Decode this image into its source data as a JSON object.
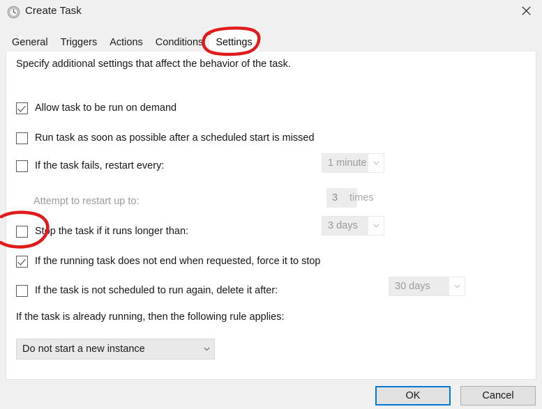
{
  "window": {
    "title": "Create Task",
    "icon": "clock-icon",
    "close_label": "×"
  },
  "tabs": [
    {
      "label": "General",
      "active": false
    },
    {
      "label": "Triggers",
      "active": false
    },
    {
      "label": "Actions",
      "active": false
    },
    {
      "label": "Conditions",
      "active": false
    },
    {
      "label": "Settings",
      "active": true
    }
  ],
  "panel": {
    "description": "Specify additional settings that affect the behavior of the task.",
    "rows": [
      {
        "id": "allow-run-on-demand",
        "label": "Allow task to be run on demand",
        "checked": true,
        "enabled": true,
        "indented": false
      },
      {
        "id": "run-asap-after-missed-start",
        "label": "Run task as soon as possible after a scheduled start is missed",
        "checked": false,
        "enabled": true,
        "indented": false
      },
      {
        "id": "restart-on-failure",
        "label": "If the task fails, restart every:",
        "checked": false,
        "enabled": true,
        "indented": false
      },
      {
        "id": "attempt-restart-count",
        "label": "Attempt to restart up to:",
        "checked": null,
        "enabled": false,
        "indented": true
      },
      {
        "id": "stop-if-runs-longer-than",
        "label": "Stop the task if it runs longer than:",
        "checked": false,
        "enabled": true,
        "indented": false
      },
      {
        "id": "force-stop-if-not-ending",
        "label": "If the running task does not end when requested, force it to stop",
        "checked": true,
        "enabled": true,
        "indented": false
      },
      {
        "id": "delete-if-not-rescheduled",
        "label": "If the task is not scheduled to run again, delete it after:",
        "checked": false,
        "enabled": true,
        "indented": false
      }
    ],
    "restart_interval": {
      "value": "1 minute",
      "enabled": false
    },
    "restart_attempts": {
      "value": "3",
      "unit": "times",
      "enabled": false
    },
    "stop_after": {
      "value": "3 days",
      "enabled": false
    },
    "delete_after": {
      "value": "30 days",
      "enabled": false
    },
    "already_running_label": "If the task is already running, then the following rule applies:",
    "already_running_rule": {
      "value": "Do not start a new instance",
      "enabled": true
    }
  },
  "footer": {
    "ok_label": "OK",
    "cancel_label": "Cancel"
  },
  "annotations": {
    "color": "#e01b1b",
    "marks": [
      {
        "name": "settings-tab-highlight",
        "shape": "ellipse"
      },
      {
        "name": "stop-task-checkbox-highlight",
        "shape": "ellipse"
      }
    ]
  }
}
